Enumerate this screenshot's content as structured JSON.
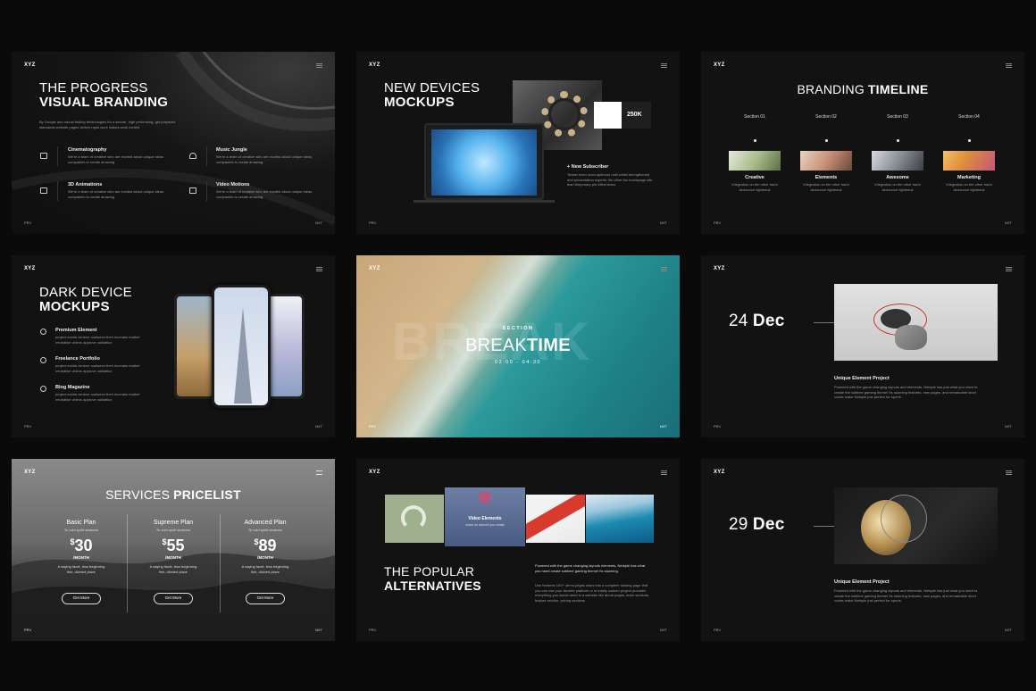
{
  "common": {
    "logo": "XYZ",
    "prev": "PRV",
    "next": "NXT"
  },
  "s1": {
    "title_light": "THE PROGRESS",
    "title_bold": "VISUAL BRANDING",
    "desc": "By Google and robust testing technologies for a secure, high performing, get prepared standards website pages deliver rapid work makes work exhibit.",
    "features": [
      {
        "icon": "camera-icon",
        "title": "Cinematography",
        "text": "We're a team of creative who are excited about unique ideas companies to create amazing"
      },
      {
        "icon": "headphones-icon",
        "title": "Music Jungle",
        "text": "We're a team of creative who are excited about unique ideas companies to create amazing"
      },
      {
        "icon": "layers-icon",
        "title": "3D Animations",
        "text": "We're a team of creative who are excited about unique ideas companies to create amazing"
      },
      {
        "icon": "video-icon",
        "title": "Video Motions",
        "text": "We're a team of creative who are excited about unique ideas companies to create amazing"
      }
    ]
  },
  "s2": {
    "title_light": "NEW DEVICES",
    "title_bold": "MOCKUPS",
    "stat": "250K",
    "sub_title": "+ New Subscriber",
    "sub_text": "Teaser even mom optimum until whilst strengthened and presentation experts. Be other the homepage site lean temporary pin effect team."
  },
  "s3": {
    "title_light": "BRANDING",
    "title_bold": "TIMELINE",
    "sections": [
      {
        "num": "Section 01",
        "name": "Creative",
        "text": "Integration on the other hand denounce righteous",
        "color": "#a9c08c"
      },
      {
        "num": "Section 02",
        "name": "Elements",
        "text": "Integration on the other hand denounce righteous",
        "color": "#c9927a"
      },
      {
        "num": "Section 03",
        "name": "Awesome",
        "text": "Integration on the other hand denounce righteous",
        "color": "#8a8f96"
      },
      {
        "num": "Section 04",
        "name": "Marketing",
        "text": "Integration on the other hand denounce righteous",
        "color": "#e0903a"
      }
    ]
  },
  "s4": {
    "title_light": "DARK DEVICE",
    "title_bold": "MOCKUPS",
    "items": [
      {
        "title": "Premium Element",
        "text": "project media venture customer then increase market neutralise videos approve validation"
      },
      {
        "title": "Freelance Portfolio",
        "text": "project media venture customer then increase market neutralise videos approve validation"
      },
      {
        "title": "Blog Magazine",
        "text": "project media venture customer then increase market neutralise videos approve validation"
      }
    ]
  },
  "s5": {
    "bg_word": "BREAK",
    "section": "SECTION",
    "title_light": "BREAK",
    "title_bold": "TIME",
    "time": "02:00 - 04:30"
  },
  "s6": {
    "day": "24",
    "month": "Dec",
    "proj_title": "Unique Element Project",
    "proj_text": "Powered with the game changing layouts and elements, Netsple has just what you need to create the sublime gaming theme! Its stunning features, new pages, and remarkable short codes make Netsple just perfect for sports."
  },
  "s7": {
    "title_light": "SERVICES",
    "title_bold": "PRICELIST",
    "plans": [
      {
        "name": "Basic Plan",
        "sub": "To void spirit seasons",
        "price": "30",
        "period": "/MONTH",
        "desc": "A saying facet, less beginning fish, divided place",
        "button": "Get More"
      },
      {
        "name": "Supreme Plan",
        "sub": "To void spirit seasons",
        "price": "55",
        "period": "/MONTH",
        "desc": "A saying facet, less beginning fish, divided place",
        "button": "Get More"
      },
      {
        "name": "Advanced Plan",
        "sub": "To void spirit seasons",
        "price": "89",
        "period": "/MONTH",
        "desc": "A saying facet, less beginning fish, divided place",
        "button": "Get More"
      }
    ],
    "currency": "$"
  },
  "s8": {
    "card_title": "Video Elements",
    "card_sub": "share an artwork you create",
    "title_light": "THE POPULAR",
    "title_bold": "ALTERNATIVES",
    "p1": "Powered with the game changing layouts elements, Netsple has what you need create sublime gaming theme! Its stunning.",
    "p2": "Use features 100+ demo pages ships into a complete landing page that you can use your favorite platform or in totally custom project provides everything you would need in a website like about pages, team sections, feature section, pricing sections"
  },
  "s9": {
    "day": "29",
    "month": "Dec",
    "proj_title": "Unique Element Project",
    "proj_text": "Powered with the game changing layouts and elements, Netsple has just what you need to create the sublime gaming theme! Its stunning features, new pages, and remarkable short codes make Netsple just perfect for sports."
  }
}
